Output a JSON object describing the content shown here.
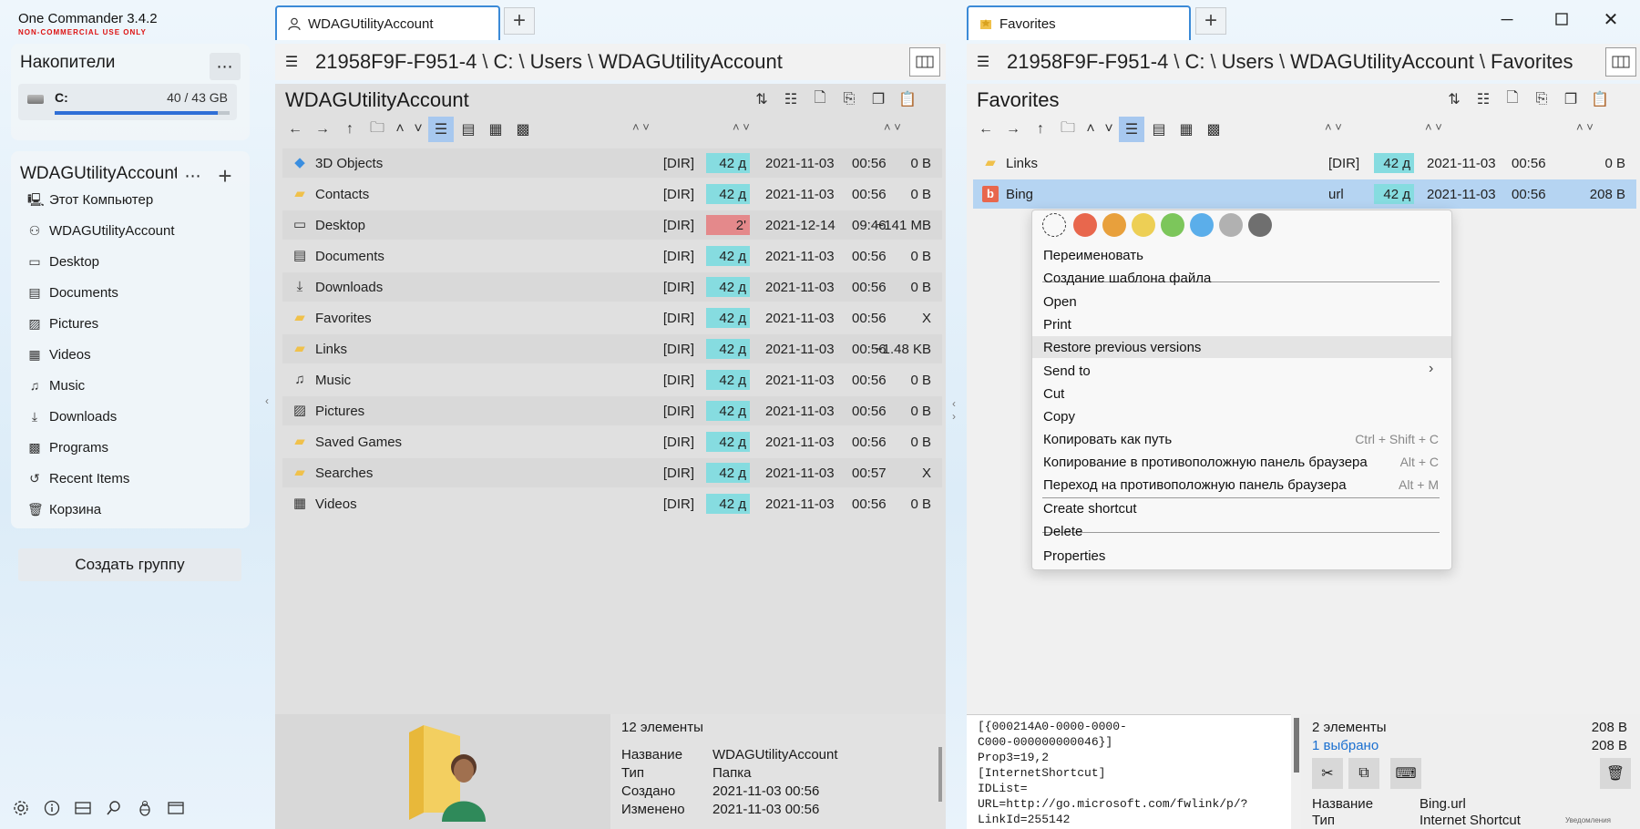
{
  "app": {
    "title": "One Commander 3.4.2",
    "subtitle": "NON-COMMERCIAL USE ONLY"
  },
  "sidebar": {
    "drives_title": "Накопители",
    "drive": {
      "label": "C:",
      "usage": "40 / 43 GB",
      "fill": 0.93
    },
    "group_title": "WDAGUtilityAccount",
    "items": [
      {
        "label": "Этот Компьютер",
        "icon": "computer-icon"
      },
      {
        "label": "WDAGUtilityAccount",
        "icon": "user-icon"
      },
      {
        "label": "Desktop",
        "icon": "desktop-icon"
      },
      {
        "label": "Documents",
        "icon": "document-icon"
      },
      {
        "label": "Pictures",
        "icon": "picture-icon"
      },
      {
        "label": "Videos",
        "icon": "video-icon"
      },
      {
        "label": "Music",
        "icon": "music-icon"
      },
      {
        "label": "Downloads",
        "icon": "download-icon"
      },
      {
        "label": "Programs",
        "icon": "grid-icon"
      },
      {
        "label": "Recent Items",
        "icon": "history-icon"
      },
      {
        "label": "Корзина",
        "icon": "trash-icon"
      }
    ],
    "create_group": "Создать группу"
  },
  "left_panel": {
    "tab_label": "WDAGUtilityAccount",
    "path": [
      "21958F9F-F951-4",
      "C:",
      "Users",
      "WDAGUtilityAccount"
    ],
    "title": "WDAGUtilityAccount",
    "rows": [
      {
        "name": "3D Objects",
        "type": "[DIR]",
        "age": "42 д",
        "date": "2021-11-03",
        "time": "00:56",
        "size": "0 B",
        "icon": "cube-icon"
      },
      {
        "name": "Contacts",
        "type": "[DIR]",
        "age": "42 д",
        "date": "2021-11-03",
        "time": "00:56",
        "size": "0 B",
        "icon": "contacts-folder-icon"
      },
      {
        "name": "Desktop",
        "type": "[DIR]",
        "age": "2'",
        "date": "2021-12-14",
        "time": "09:46",
        "size": "~141 MB",
        "icon": "desktop-icon"
      },
      {
        "name": "Documents",
        "type": "[DIR]",
        "age": "42 д",
        "date": "2021-11-03",
        "time": "00:56",
        "size": "0 B",
        "icon": "document-icon"
      },
      {
        "name": "Downloads",
        "type": "[DIR]",
        "age": "42 д",
        "date": "2021-11-03",
        "time": "00:56",
        "size": "0 B",
        "icon": "download-icon"
      },
      {
        "name": "Favorites",
        "type": "[DIR]",
        "age": "42 д",
        "date": "2021-11-03",
        "time": "00:56",
        "size": "X",
        "icon": "star-folder-icon"
      },
      {
        "name": "Links",
        "type": "[DIR]",
        "age": "42 д",
        "date": "2021-11-03",
        "time": "00:56",
        "size": "~1.48 KB",
        "icon": "link-folder-icon"
      },
      {
        "name": "Music",
        "type": "[DIR]",
        "age": "42 д",
        "date": "2021-11-03",
        "time": "00:56",
        "size": "0 B",
        "icon": "music-icon"
      },
      {
        "name": "Pictures",
        "type": "[DIR]",
        "age": "42 д",
        "date": "2021-11-03",
        "time": "00:56",
        "size": "0 B",
        "icon": "picture-icon"
      },
      {
        "name": "Saved Games",
        "type": "[DIR]",
        "age": "42 д",
        "date": "2021-11-03",
        "time": "00:56",
        "size": "0 B",
        "icon": "games-folder-icon"
      },
      {
        "name": "Searches",
        "type": "[DIR]",
        "age": "42 д",
        "date": "2021-11-03",
        "time": "00:57",
        "size": "X",
        "icon": "search-folder-icon"
      },
      {
        "name": "Videos",
        "type": "[DIR]",
        "age": "42 д",
        "date": "2021-11-03",
        "time": "00:56",
        "size": "0 B",
        "icon": "video-icon"
      }
    ],
    "info": {
      "count": "12 элементы",
      "fields": [
        {
          "k": "Название",
          "v": "WDAGUtilityAccount"
        },
        {
          "k": "Тип",
          "v": "Папка"
        },
        {
          "k": "Создано",
          "v": "2021-11-03  00:56"
        },
        {
          "k": "Изменено",
          "v": "2021-11-03  00:56"
        }
      ]
    }
  },
  "right_panel": {
    "tab_label": "Favorites",
    "path": [
      "21958F9F-F951-4",
      "C:",
      "Users",
      "WDAGUtilityAccount",
      "Favorites"
    ],
    "title": "Favorites",
    "rows": [
      {
        "name": "Links",
        "type": "[DIR]",
        "age": "42 д",
        "date": "2021-11-03",
        "time": "00:56",
        "size": "0 B"
      },
      {
        "name": "Bing",
        "type": "url",
        "age": "42 д",
        "date": "2021-11-03",
        "time": "00:56",
        "size": "208 B"
      }
    ],
    "preview_text": "[{000214A0-0000-0000-\nC000-000000000046}]\nProp3=19,2\n[InternetShortcut]\nIDList=\nURL=http://go.microsoft.com/fwlink/p/?\nLinkId=255142",
    "info": {
      "count": "2 элементы",
      "count_size": "208 B",
      "selected": "1 выбрано",
      "selected_size": "208 B",
      "fields": [
        {
          "k": "Название",
          "v": "Bing.url"
        },
        {
          "k": "Тип",
          "v": "Internet Shortcut"
        }
      ],
      "notice": "Уведомления"
    }
  },
  "context_menu": {
    "colors": [
      "#e8674d",
      "#e8a03c",
      "#edcf55",
      "#7cc65b",
      "#5baeea",
      "#b1b1b1",
      "#6f6f6f"
    ],
    "items": [
      {
        "label": "Переименовать",
        "shortcut": ""
      },
      {
        "label": "Создание шаблона файла",
        "shortcut": ""
      },
      {
        "label": "Open",
        "shortcut": ""
      },
      {
        "label": "Print",
        "shortcut": ""
      },
      {
        "label": "Restore previous versions",
        "shortcut": ""
      },
      {
        "label": "Send to",
        "shortcut": ""
      },
      {
        "label": "Cut",
        "shortcut": ""
      },
      {
        "label": "Copy",
        "shortcut": ""
      },
      {
        "label": "Копировать как путь",
        "shortcut": "Ctrl + Shift + C"
      },
      {
        "label": "Копирование в противоположную панель браузера",
        "shortcut": "Alt + C"
      },
      {
        "label": "Переход на противоположную панель браузера",
        "shortcut": "Alt + M"
      },
      {
        "label": "Create shortcut",
        "shortcut": ""
      },
      {
        "label": "Delete",
        "shortcut": ""
      },
      {
        "label": "Properties",
        "shortcut": ""
      }
    ]
  }
}
